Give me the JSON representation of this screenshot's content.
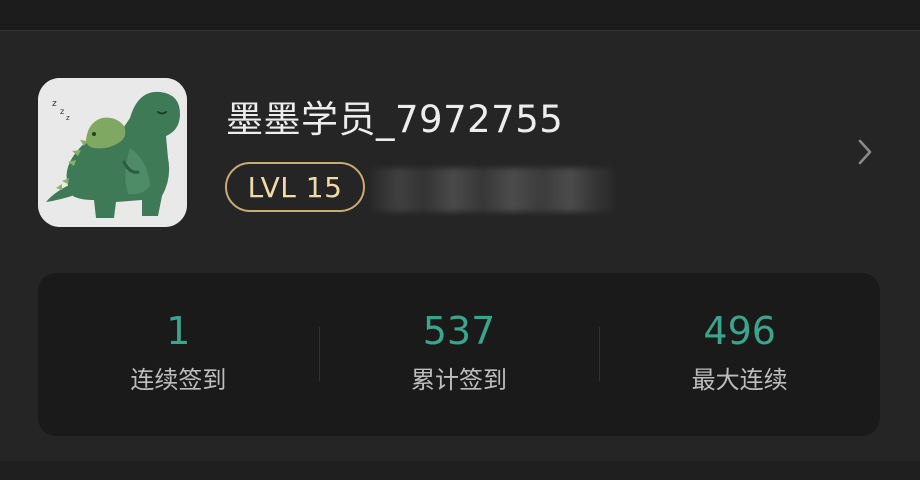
{
  "profile": {
    "username": "墨墨学员_7972755",
    "level_badge": "LVL 15",
    "avatar": "sleeping-dinosaur-avatar",
    "arrow_icon": "chevron-right-icon"
  },
  "stats": [
    {
      "value": "1",
      "label": "连续签到"
    },
    {
      "value": "537",
      "label": "累计签到"
    },
    {
      "value": "496",
      "label": "最大连续"
    }
  ],
  "colors": {
    "background": "#1f1f1f",
    "card": "#252525",
    "stats_panel": "#1a1a1a",
    "accent_green": "#3aa58d",
    "badge_gold": "#c9ac74"
  }
}
